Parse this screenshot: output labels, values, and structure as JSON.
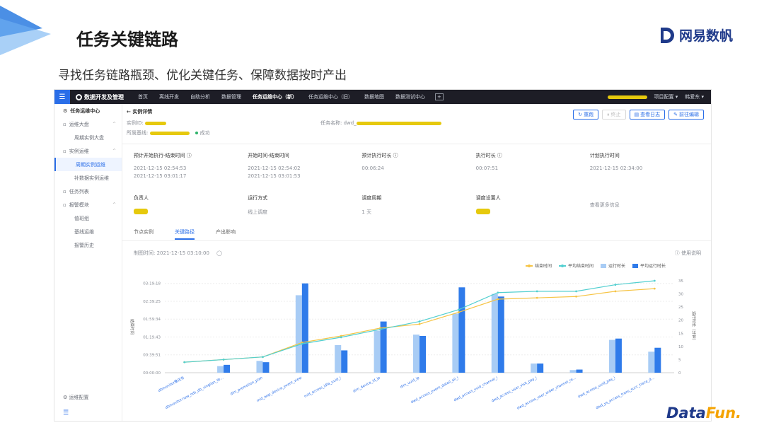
{
  "slide": {
    "title": "任务关键链路",
    "subtitle": "寻找任务链路瓶颈、优化关键任务、保障数据按时产出",
    "brand": "网易数帆",
    "footer_logo_a": "Data",
    "footer_logo_b": "Fun."
  },
  "topbar": {
    "app_name": "数据开发及管理",
    "nav": [
      "首页",
      "离线开发",
      "自助分析",
      "数据管理",
      "任务运维中心（新）",
      "任务运维中心（旧）",
      "数据地图",
      "数据测试中心"
    ],
    "active_nav": "任务运维中心（新）",
    "project_config": "项目配置 ▾",
    "user": "韩爱东 ▾"
  },
  "sidebar": {
    "header": "任务运维中心",
    "items": [
      {
        "label": "运维大盘",
        "type": "group"
      },
      {
        "label": "周期实例大盘",
        "type": "sub"
      },
      {
        "label": "实例运维",
        "type": "group"
      },
      {
        "label": "周期实例运维",
        "type": "sub",
        "active": true
      },
      {
        "label": "补数据实例运维",
        "type": "sub"
      },
      {
        "label": "任务列表",
        "type": "group"
      },
      {
        "label": "报警模块",
        "type": "group"
      },
      {
        "label": "值班组",
        "type": "sub"
      },
      {
        "label": "基线运维",
        "type": "sub"
      },
      {
        "label": "报警历史",
        "type": "sub"
      }
    ],
    "bottom": "运维配置"
  },
  "detail": {
    "back": "实例详情",
    "instance_id_label": "实例ID:",
    "baseline_label": "所属基线:",
    "status": "成功",
    "task_name_label": "任务名称: dwd_",
    "buttons": {
      "rerun": "重跑",
      "stop": "终止",
      "log": "查看日志",
      "edit": "前往编辑"
    },
    "row1": [
      {
        "label": "预计开始执行-结束时间 ⓘ",
        "values": [
          "2021-12-15 02:54:53",
          "2021-12-15 03:01:17"
        ]
      },
      {
        "label": "开始时间-结束时间",
        "values": [
          "2021-12-15 02:54:02",
          "2021-12-15 03:01:53"
        ]
      },
      {
        "label": "预计执行时长 ⓘ",
        "values": [
          "00:06:24"
        ]
      },
      {
        "label": "执行时长 ⓘ",
        "values": [
          "00:07:51"
        ]
      },
      {
        "label": "计划执行时间",
        "values": [
          "2021-12-15 02:34:00"
        ]
      }
    ],
    "row2": [
      {
        "label": "负责人",
        "value": ""
      },
      {
        "label": "运行方式",
        "value": "线上调度"
      },
      {
        "label": "调度周期",
        "value": "1 天"
      },
      {
        "label": "调度设置人",
        "value": ""
      },
      {
        "label": "",
        "value": "查看更多信息"
      }
    ],
    "tabs": [
      "节点实例",
      "关键路径",
      "产出影响"
    ],
    "active_tab": "关键路径",
    "draw_time": "制图时间: 2021-12-15 03:10:00",
    "help": "使用说明"
  },
  "chart_data": {
    "type": "bar",
    "categories": [
      "dbmonitor推任务",
      "dbmonitor.new_ods_db_xinglian_tb...",
      "dim_promotion_plan",
      "mid_wsp_device_event_view",
      "mid_access_idfa_uuid_i",
      "dim_device_id_ip",
      "dim_uuid_ip",
      "dwd_access_event_detail_all_i",
      "dwd_access_uuid_channel_i",
      "dwd_access_user_visit_pay_i",
      "dwd_access_user_order_channel_re...",
      "dwd_access_uuid_pay_i",
      "dwd_ys_access_trans_succ_trace_d..."
    ],
    "ylabel_left": "结束时间",
    "ylabel_right": "运行时长（分钟）",
    "left_ticks": [
      "00:00:00",
      "00:39:51",
      "01:19:43",
      "01:59:34",
      "02:39:25",
      "03:19:18"
    ],
    "right_ticks": [
      0,
      5,
      10,
      15,
      20,
      25,
      30,
      35
    ],
    "ylim": [
      0,
      35
    ],
    "legend": [
      "结束时间",
      "平均结束时间",
      "运行时长",
      "平均运行时长"
    ],
    "series": [
      {
        "name": "运行时长",
        "kind": "bar",
        "color": "#a8ccf5",
        "values": [
          0,
          2.5,
          4.5,
          29.5,
          10.5,
          16,
          14.5,
          22.5,
          30,
          3.5,
          1,
          12.5,
          8
        ]
      },
      {
        "name": "平均运行时长",
        "kind": "bar",
        "color": "#2f7bea",
        "values": [
          0,
          3,
          4,
          34,
          8.5,
          19.5,
          14,
          32.5,
          29,
          3.5,
          1.2,
          13,
          9.5
        ]
      },
      {
        "name": "结束时间",
        "kind": "line",
        "color": "#f6c445",
        "values": [
          4,
          5,
          6,
          11.5,
          14,
          17,
          18.5,
          23,
          28,
          28.5,
          29,
          31,
          32
        ]
      },
      {
        "name": "平均结束时间",
        "kind": "line",
        "color": "#52cfd0",
        "values": [
          4,
          5,
          6,
          11,
          13.5,
          16.5,
          19.5,
          24,
          30.5,
          31,
          31,
          33.5,
          35
        ]
      }
    ]
  }
}
